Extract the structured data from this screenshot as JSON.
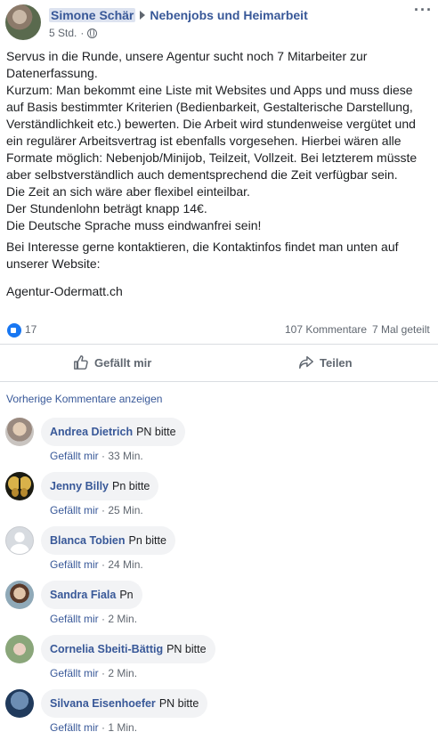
{
  "header": {
    "author": "Simone Schär",
    "group": "Nebenjobs und Heimarbeit",
    "time": "5 Std.",
    "privacy_icon": "globe-icon",
    "more_icon": "more-options-icon"
  },
  "post": {
    "para1": "Servus in die Runde, unsere Agentur sucht noch 7 Mitarbeiter zur Datenerfassung.\nKurzum: Man bekommt eine Liste mit Websites und Apps und muss diese auf Basis bestimmter Kriterien (Bedienbarkeit, Gestalterische Darstellung, Verständlichkeit etc.) bewerten. Die Arbeit wird stundenweise vergütet und ein regulärer Arbeitsvertrag ist ebenfalls vorgesehen. Hierbei wären alle Formate möglich: Nebenjob/Minijob, Teilzeit, Vollzeit. Bei letzterem müsste aber selbstverständlich auch dementsprechend die Zeit verfügbar sein.\nDie Zeit an sich wäre aber flexibel einteilbar.\nDer Stundenlohn beträgt knapp 14€.\nDie Deutsche Sprache muss eindwanfrei sein!",
    "para2": "Bei Interesse gerne kontaktieren, die Kontaktinfos findet man unten auf unserer Website:",
    "para3": "Agentur-Odermatt.ch"
  },
  "stats": {
    "likes": "17",
    "comments": "107 Kommentare",
    "shares": "7 Mal geteilt"
  },
  "actions": {
    "like_label": "Gefällt mir",
    "share_label": "Teilen"
  },
  "comments_section": {
    "previous_label": "Vorherige Kommentare anzeigen",
    "like_label": "Gefällt mir",
    "items": [
      {
        "name": "Andrea Dietrich",
        "text": "PN bitte",
        "time": "33 Min."
      },
      {
        "name": "Jenny Billy",
        "text": "Pn bitte",
        "time": "25 Min."
      },
      {
        "name": "Blanca Tobien",
        "text": "Pn bitte",
        "time": "24 Min."
      },
      {
        "name": "Sandra Fiala",
        "text": "Pn",
        "time": "2 Min."
      },
      {
        "name": "Cornelia Sbeiti-Bättig",
        "text": "PN bitte",
        "time": "2 Min."
      },
      {
        "name": "Silvana Eisenhoefer",
        "text": "PN bitte",
        "time": "1 Min."
      }
    ]
  },
  "colors": {
    "link": "#385898",
    "like_blue": "#1877f2",
    "meta_gray": "#606770",
    "bubble_bg": "#f2f3f5"
  }
}
